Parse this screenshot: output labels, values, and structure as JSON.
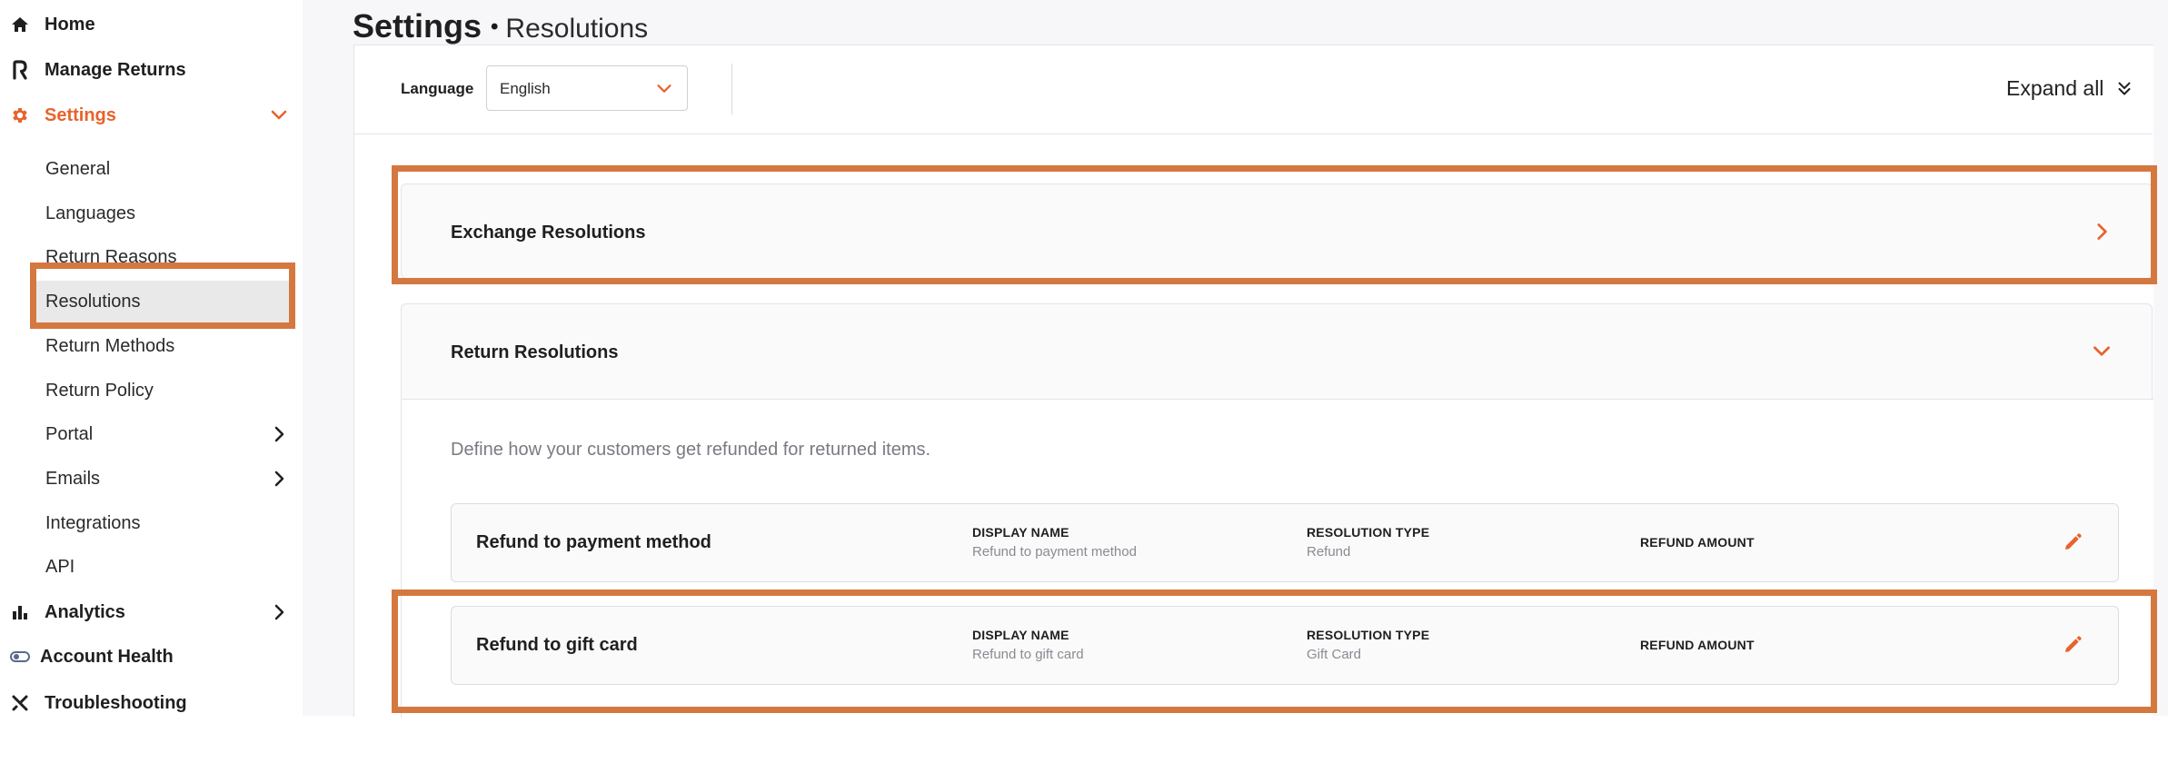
{
  "sidebar": {
    "items": [
      {
        "label": "Home",
        "icon": "home-icon"
      },
      {
        "label": "Manage Returns",
        "icon": "returns-logo-icon"
      },
      {
        "label": "Settings",
        "icon": "gear-icon",
        "active": true
      }
    ],
    "settings_sub": [
      {
        "label": "General"
      },
      {
        "label": "Languages"
      },
      {
        "label": "Return Reasons"
      },
      {
        "label": "Resolutions",
        "selected": true
      },
      {
        "label": "Return Methods"
      },
      {
        "label": "Return Policy"
      },
      {
        "label": "Portal"
      },
      {
        "label": "Emails"
      },
      {
        "label": "Integrations"
      },
      {
        "label": "API"
      }
    ],
    "bottom_items": [
      {
        "label": "Analytics",
        "icon": "bar-chart-icon"
      },
      {
        "label": "Account Health",
        "icon": "health-toggle-icon"
      },
      {
        "label": "Troubleshooting",
        "icon": "tools-icon"
      }
    ]
  },
  "header": {
    "title": "Settings",
    "separator": "•",
    "subtitle": "Resolutions"
  },
  "toolbar": {
    "language_label": "Language",
    "language_value": "English",
    "expand_all_label": "Expand all"
  },
  "sections": {
    "exchange": {
      "title": "Exchange Resolutions"
    },
    "return": {
      "title": "Return Resolutions",
      "description": "Define how your customers get refunded for returned items.",
      "rows": [
        {
          "name": "Refund to payment method",
          "display_name_label": "DISPLAY NAME",
          "display_name": "Refund to payment method",
          "resolution_type_label": "RESOLUTION TYPE",
          "resolution_type": "Refund",
          "refund_amount_label": "REFUND AMOUNT"
        },
        {
          "name": "Refund to gift card",
          "display_name_label": "DISPLAY NAME",
          "display_name": "Refund to gift card",
          "resolution_type_label": "RESOLUTION TYPE",
          "resolution_type": "Gift Card",
          "refund_amount_label": "REFUND AMOUNT"
        }
      ]
    }
  },
  "colors": {
    "accent": "#e8622c",
    "annotation": "#d5783f",
    "selected_bg": "#e9e9e9"
  }
}
